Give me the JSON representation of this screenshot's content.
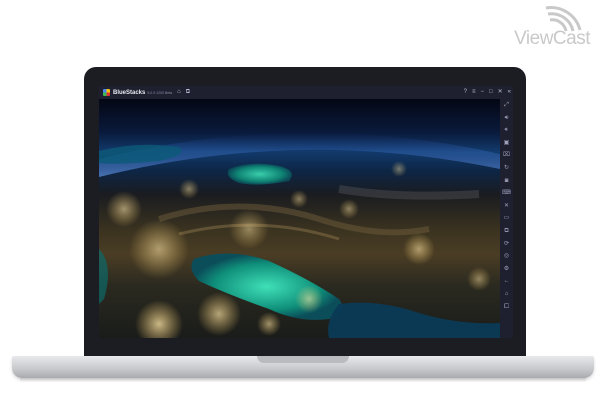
{
  "watermark": {
    "brand": "ViewCast"
  },
  "app": {
    "title": "BlueStacks",
    "version": "5.0.0.1200 Beta"
  },
  "titlebar": {
    "left_icons": [
      "home-icon",
      "multi-instance-icon"
    ],
    "right_icons": [
      "help-icon",
      "menu-icon",
      "minimize-icon",
      "maximize-icon",
      "close-icon",
      "collapse-sidebar-icon"
    ]
  },
  "sidebar": {
    "icons": [
      "fullscreen-icon",
      "volume-up-icon",
      "volume-down-icon",
      "media-icon",
      "lock-icon",
      "rotate-icon",
      "camera-icon",
      "keyboard-icon",
      "shake-icon",
      "folder-icon",
      "macro-icon",
      "sync-icon",
      "eco-icon",
      "settings-icon",
      "back-icon",
      "home-icon",
      "recent-apps-icon"
    ]
  },
  "wallpaper": {
    "subject": "earth-at-night"
  },
  "colors": {
    "titlebar": "#1e2030",
    "bezel": "#1b1d22",
    "watermark": "#c9c9c9"
  }
}
